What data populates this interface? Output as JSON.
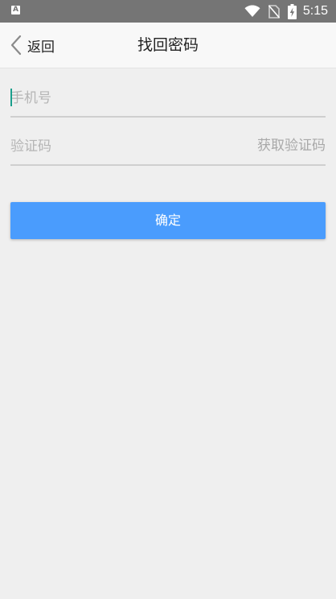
{
  "status_bar": {
    "left_icon_glyph": "A",
    "time": "5:15",
    "icons": [
      "app-notification-icon",
      "wifi-icon",
      "no-sim-icon",
      "battery-charging-icon"
    ]
  },
  "header": {
    "back_label": "返回",
    "title": "找回密码"
  },
  "form": {
    "phone_placeholder": "手机号",
    "code_placeholder": "验证码",
    "get_code_label": "获取验证码",
    "submit_label": "确定"
  },
  "colors": {
    "status_bar": "#757575",
    "app_bar": "#f8f8f8",
    "background": "#efefef",
    "accent_button": "#4a9cfd",
    "cursor": "#1a9f8c",
    "field_underline": "#cfcfcf"
  }
}
